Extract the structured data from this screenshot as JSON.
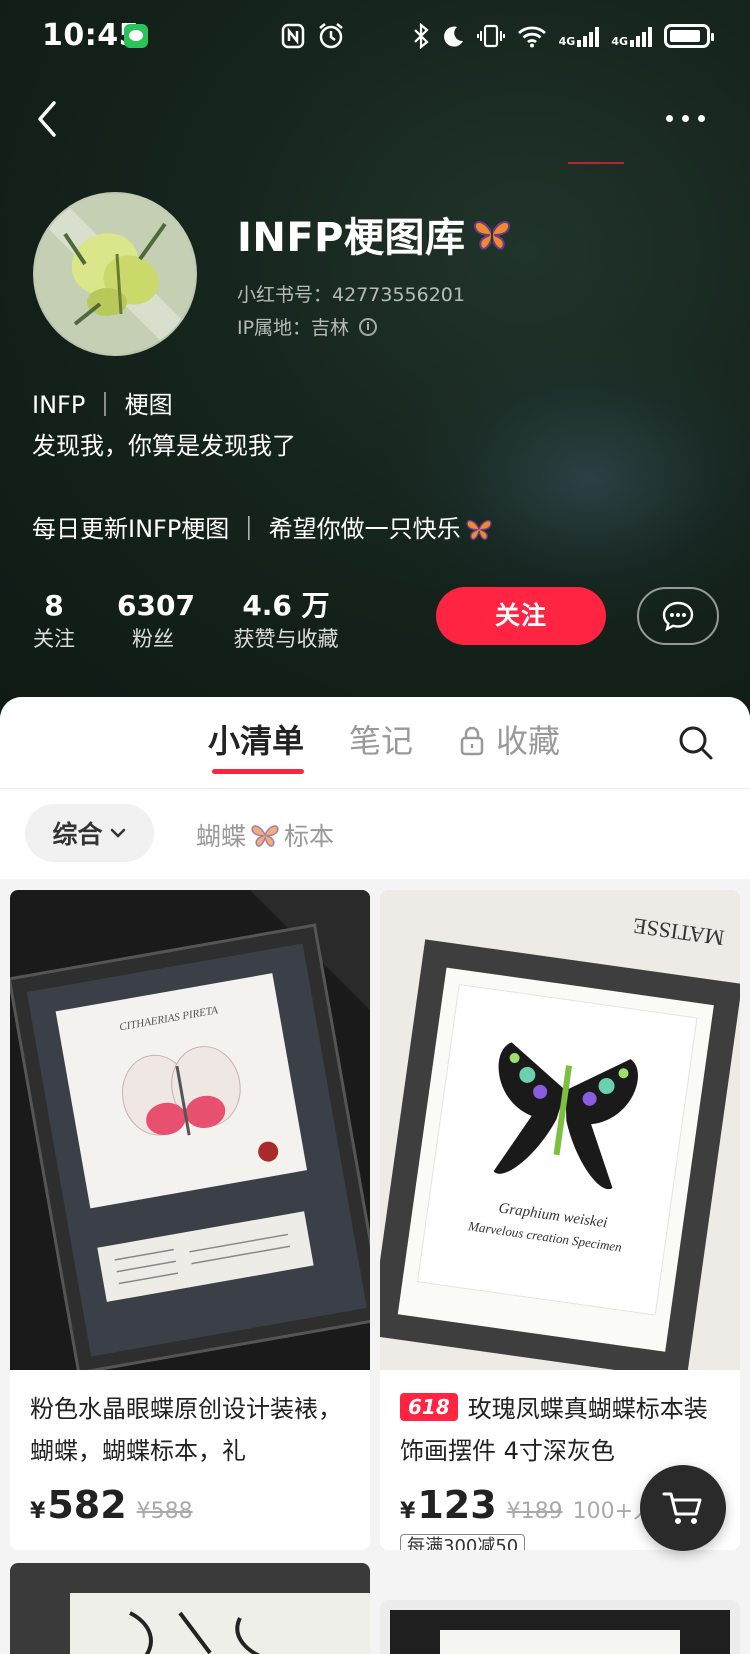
{
  "status_bar": {
    "time": "10:45",
    "network_1": "4G",
    "network_2": "4G"
  },
  "profile": {
    "name": "INFP梗图库",
    "id_label": "小红书号：42773556201",
    "ip_label": "IP属地：吉林",
    "bio_line1": "INFP ｜ 梗图",
    "bio_line2": "发现我，你算是发现我了",
    "bio_line3": "每日更新INFP梗图 ｜ 希望你做一只快乐",
    "stats": [
      {
        "value": "8",
        "label": "关注"
      },
      {
        "value": "6307",
        "label": "粉丝"
      },
      {
        "value": "4.6 万",
        "label": "获赞与收藏"
      }
    ],
    "follow_label": "关注"
  },
  "tabs": {
    "lists": "小清单",
    "notes": "笔记",
    "favorites": "收藏"
  },
  "filters": {
    "all": "综合",
    "butterfly_a": "蝴蝶",
    "butterfly_b": "标本"
  },
  "products": [
    {
      "title": "粉色水晶眼蝶原创设计装裱，蝴蝶，蝴蝶标本，礼",
      "currency": "¥",
      "price": "582",
      "original_price": "¥588",
      "image_text": "CITHAERIAS PIRETA"
    },
    {
      "badge": "618",
      "title": "玫瑰凤蝶真蝴蝶标本装饰画摆件 4寸深灰色",
      "currency": "¥",
      "price": "123",
      "original_price": "¥189",
      "sold": "100+人已买",
      "promo": "每满300减50",
      "image_text_1": "Graphium weiskei",
      "image_text_2": "Marvelous creation Specimen",
      "image_text_3": "MATISSE"
    }
  ],
  "colors": {
    "accent": "#ff2442",
    "header_bg": "#15241c"
  }
}
